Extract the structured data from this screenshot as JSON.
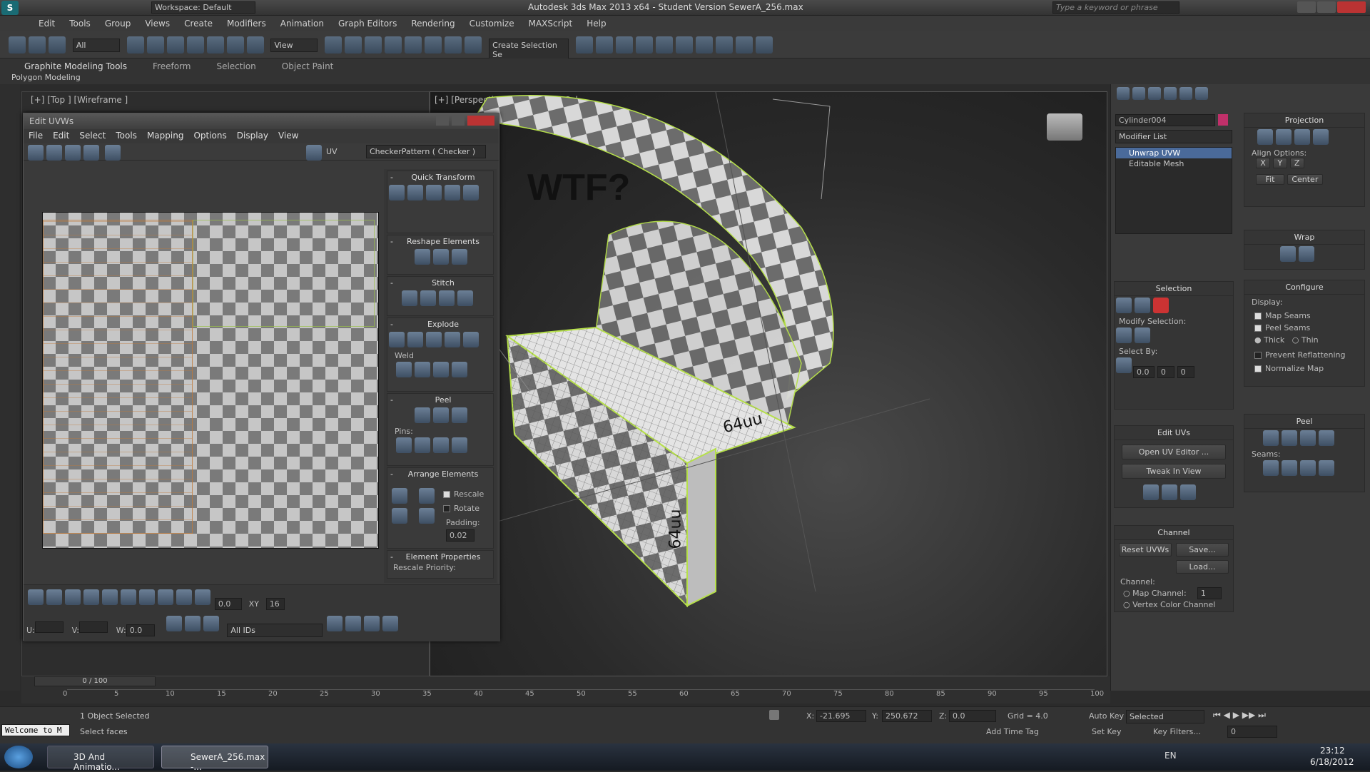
{
  "titlebar": {
    "workspace": "Workspace: Default",
    "title": "Autodesk 3ds Max 2013 x64 - Student Version    SewerA_256.max",
    "search_placeholder": "Type a keyword or phrase"
  },
  "menubar": [
    "Edit",
    "Tools",
    "Group",
    "Views",
    "Create",
    "Modifiers",
    "Animation",
    "Graph Editors",
    "Rendering",
    "Customize",
    "MAXScript",
    "Help"
  ],
  "toolbar": {
    "filter": "All",
    "refcoord": "View",
    "selection_set": "Create Selection Se"
  },
  "ribbon": {
    "tabs": [
      "Graphite Modeling Tools",
      "Freeform",
      "Selection",
      "Object Paint"
    ],
    "subtitle": "Polygon Modeling"
  },
  "viewports": {
    "top_label": "[+] [Top ] [Wireframe ]",
    "persp_label": "[+] [Perspective ] [Consistent Col..."
  },
  "annotations": {
    "wtf": "WTF?",
    "label1": "64uu",
    "label2": "64uu"
  },
  "uvw": {
    "title": "Edit UVWs",
    "menu": [
      "File",
      "Edit",
      "Select",
      "Tools",
      "Mapping",
      "Options",
      "Display",
      "View"
    ],
    "uv_label": "UV",
    "checker": "CheckerPattern  ( Checker )",
    "rollouts": {
      "quick_transform": "Quick Transform",
      "reshape": "Reshape Elements",
      "stitch": "Stitch",
      "explode": "Explode",
      "weld": "Weld",
      "peel": "Peel",
      "pins": "Pins:",
      "arrange": "Arrange Elements",
      "rescale": "Rescale",
      "rotate": "Rotate",
      "padding": "Padding:",
      "padding_val": "0.02",
      "element_props": "Element Properties",
      "rescale_priority": "Rescale Priority:"
    },
    "bottom": {
      "u": "U:",
      "v": "V:",
      "w": "W:",
      "w_val": "0.0",
      "val1": "0.0",
      "val16": "16",
      "xy": "XY",
      "ids": "All IDs"
    }
  },
  "cmd": {
    "object_name": "Cylinder004",
    "modifier_list": "Modifier List",
    "stack": [
      "Unwrap UVW",
      "Editable Mesh"
    ],
    "selection": "Selection",
    "modify_selection": "Modify Selection:",
    "select_by": "Select By:",
    "sel_val1": "0.0",
    "sel_val2": "0",
    "sel_val3": "0",
    "edit_uvs": "Edit UVs",
    "open_editor": "Open UV Editor ...",
    "tweak": "Tweak In View",
    "channel": "Channel",
    "reset": "Reset UVWs",
    "save": "Save...",
    "load": "Load...",
    "channel_label": "Channel:",
    "map_channel": "Map Channel:",
    "map_channel_val": "1",
    "vertex_color": "Vertex Color Channel",
    "projection": "Projection",
    "align": "Align Options:",
    "x": "X",
    "y": "Y",
    "z": "Z",
    "fit": "Fit",
    "center": "Center",
    "wrap": "Wrap",
    "configure": "Configure",
    "display": "Display:",
    "map_seams": "Map Seams",
    "peel_seams": "Peel Seams",
    "thick": "Thick",
    "thin": "Thin",
    "prevent": "Prevent Reflattening",
    "normalize": "Normalize Map",
    "peel": "Peel",
    "seams": "Seams:"
  },
  "timeline": {
    "frame": "0 / 100",
    "ticks": [
      "0",
      "5",
      "10",
      "15",
      "20",
      "25",
      "30",
      "35",
      "40",
      "45",
      "50",
      "55",
      "60",
      "65",
      "70",
      "75",
      "80",
      "85",
      "90",
      "95",
      "100"
    ]
  },
  "status": {
    "welcome": "Welcome to M",
    "selected": "1 Object Selected",
    "prompt": "Select faces",
    "x": "X:",
    "x_val": "-21.695",
    "y": "Y:",
    "y_val": "250.672",
    "z": "Z:",
    "z_val": "0.0",
    "grid": "Grid = 4.0",
    "autokey": "Auto Key",
    "setkey": "Set Key",
    "selected_dd": "Selected",
    "keyfilters": "Key Filters...",
    "addtimetag": "Add Time Tag",
    "frame_field": "0"
  },
  "taskbar": {
    "app1": "3D And Animatio...",
    "app2": "SewerA_256.max -...",
    "lang": "EN",
    "time": "23:12",
    "date": "6/18/2012"
  }
}
